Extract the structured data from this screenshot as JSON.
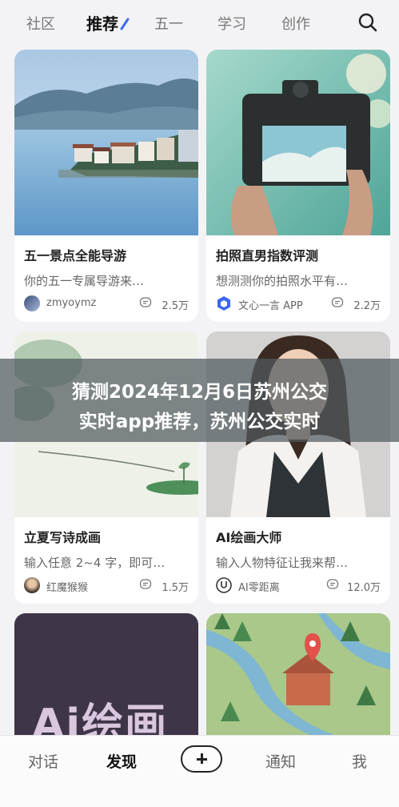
{
  "topnav": {
    "tabs": [
      "社区",
      "推荐",
      "五一",
      "学习",
      "创作"
    ],
    "active_tab": "推荐"
  },
  "cards": [
    {
      "title": "五一景点全能导游",
      "desc": "你的五一专属导游来…",
      "author": "zmyoymz",
      "count": "2.5万",
      "image": "coastal-village-photo"
    },
    {
      "title": "拍照直男指数评测",
      "desc": "想测测你的拍照水平有…",
      "author": "文心一言 APP",
      "count": "2.2万",
      "image": "camera-photo"
    },
    {
      "title": "立夏写诗成画",
      "desc": "输入任意 2~4 字，即可…",
      "author": "红魔猴猴",
      "count": "1.5万",
      "image": "ink-lotus-painting"
    },
    {
      "title": "AI绘画大师",
      "desc": "输入人物特征让我来帮…",
      "author": "AI零距离",
      "count": "12.0万",
      "image": "portrait-photo"
    },
    {
      "title": "",
      "desc": "",
      "author": "",
      "count": "",
      "image": "ai-painting-cover",
      "cover_text": "Ai绘画"
    },
    {
      "title": "",
      "desc": "",
      "author": "",
      "count": "",
      "image": "isometric-map-illustration"
    }
  ],
  "banner": {
    "line1": "猜测2024年12月6日苏州公交",
    "line2": "实时app推荐，苏州公交实时"
  },
  "bottomnav": {
    "items": [
      "对话",
      "发现",
      "通知",
      "我"
    ],
    "active": "发现"
  }
}
